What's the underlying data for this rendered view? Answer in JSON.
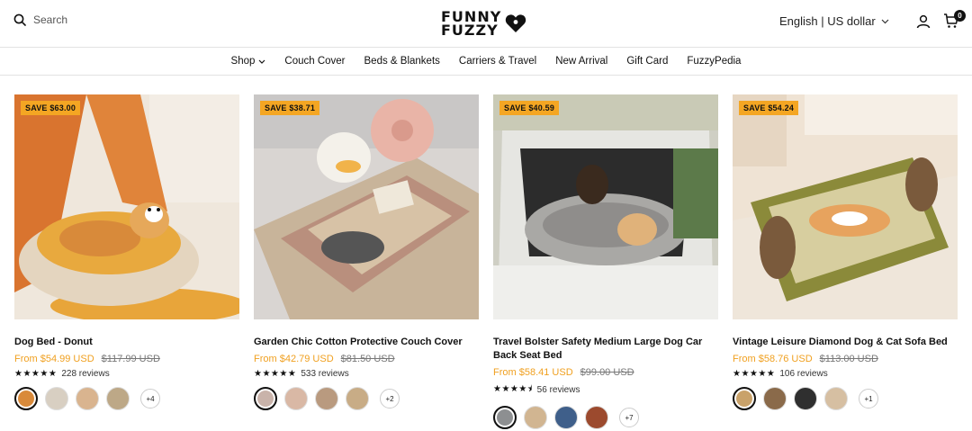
{
  "header": {
    "search_label": "Search",
    "brand_line1": "FUNNY",
    "brand_line2": "FUZZY",
    "locale": "English | US dollar",
    "cart_count": "0"
  },
  "nav": {
    "items": [
      "Shop",
      "Couch Cover",
      "Beds & Blankets",
      "Carriers & Travel",
      "New Arrival",
      "Gift Card",
      "FuzzyPedia"
    ]
  },
  "products": [
    {
      "badge": "SAVE $63.00",
      "title": "Dog Bed - Donut",
      "price": "From $54.99 USD",
      "compare_price": "$117.99 USD",
      "stars": "★★★★★",
      "reviews": "228 reviews",
      "more_swatches": "+4",
      "swatch_colors": [
        "#d98a3a",
        "#d8cfc2",
        "#d9b48f",
        "#bda887"
      ]
    },
    {
      "badge": "SAVE $38.71",
      "title": "Garden Chic Cotton Protective Couch Cover",
      "price": "From $42.79 USD",
      "compare_price": "$81.50 USD",
      "stars": "★★★★★",
      "reviews": "533 reviews",
      "more_swatches": "+2",
      "swatch_colors": [
        "#c9b3aa",
        "#d9b8a5",
        "#b99a7f",
        "#c8ac86"
      ]
    },
    {
      "badge": "SAVE $40.59",
      "title": "Travel Bolster Safety Medium Large Dog Car Back Seat Bed",
      "price": "From $58.41 USD",
      "compare_price": "$99.00 USD",
      "stars": "★★★★⯨",
      "reviews": "56 reviews",
      "more_swatches": "+7",
      "swatch_colors": [
        "#8d8f91",
        "#d1b591",
        "#3f5f8a",
        "#9c4a2e"
      ]
    },
    {
      "badge": "SAVE $54.24",
      "title": "Vintage Leisure Diamond Dog & Cat Sofa Bed",
      "price": "From $58.76 USD",
      "compare_price": "$113.00 USD",
      "stars": "★★★★★",
      "reviews": "106 reviews",
      "more_swatches": "+1",
      "swatch_colors": [
        "#c9a26a",
        "#8a6a4a",
        "#2f2f2f",
        "#d6bfa2"
      ]
    }
  ],
  "colors": {
    "accent": "#f4a623",
    "price": "#f0a020"
  }
}
